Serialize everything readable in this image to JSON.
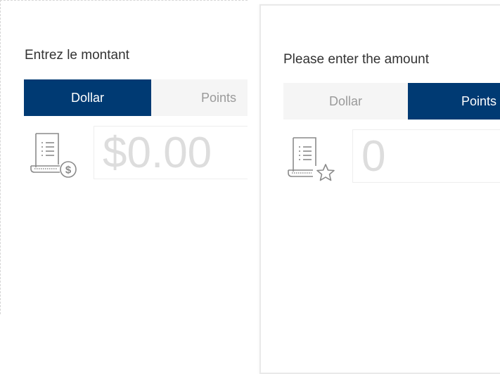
{
  "left_panel": {
    "prompt": "Entrez le montant",
    "tabs": [
      {
        "label": "Dollar",
        "active": true
      },
      {
        "label": "Points",
        "active": false
      }
    ],
    "amount_placeholder": "$0.00",
    "icon": "receipt-dollar-icon"
  },
  "right_panel": {
    "prompt": "Please enter the amount",
    "tabs": [
      {
        "label": "Dollar",
        "active": false
      },
      {
        "label": "Points",
        "active": true
      }
    ],
    "amount_placeholder": "0",
    "icon": "receipt-star-icon"
  },
  "colors": {
    "active_tab": "#003a73",
    "inactive_tab": "#f5f5f5",
    "inactive_text": "#9a9a9a",
    "placeholder": "#dddddd",
    "icon_stroke": "#8a8a8a"
  }
}
